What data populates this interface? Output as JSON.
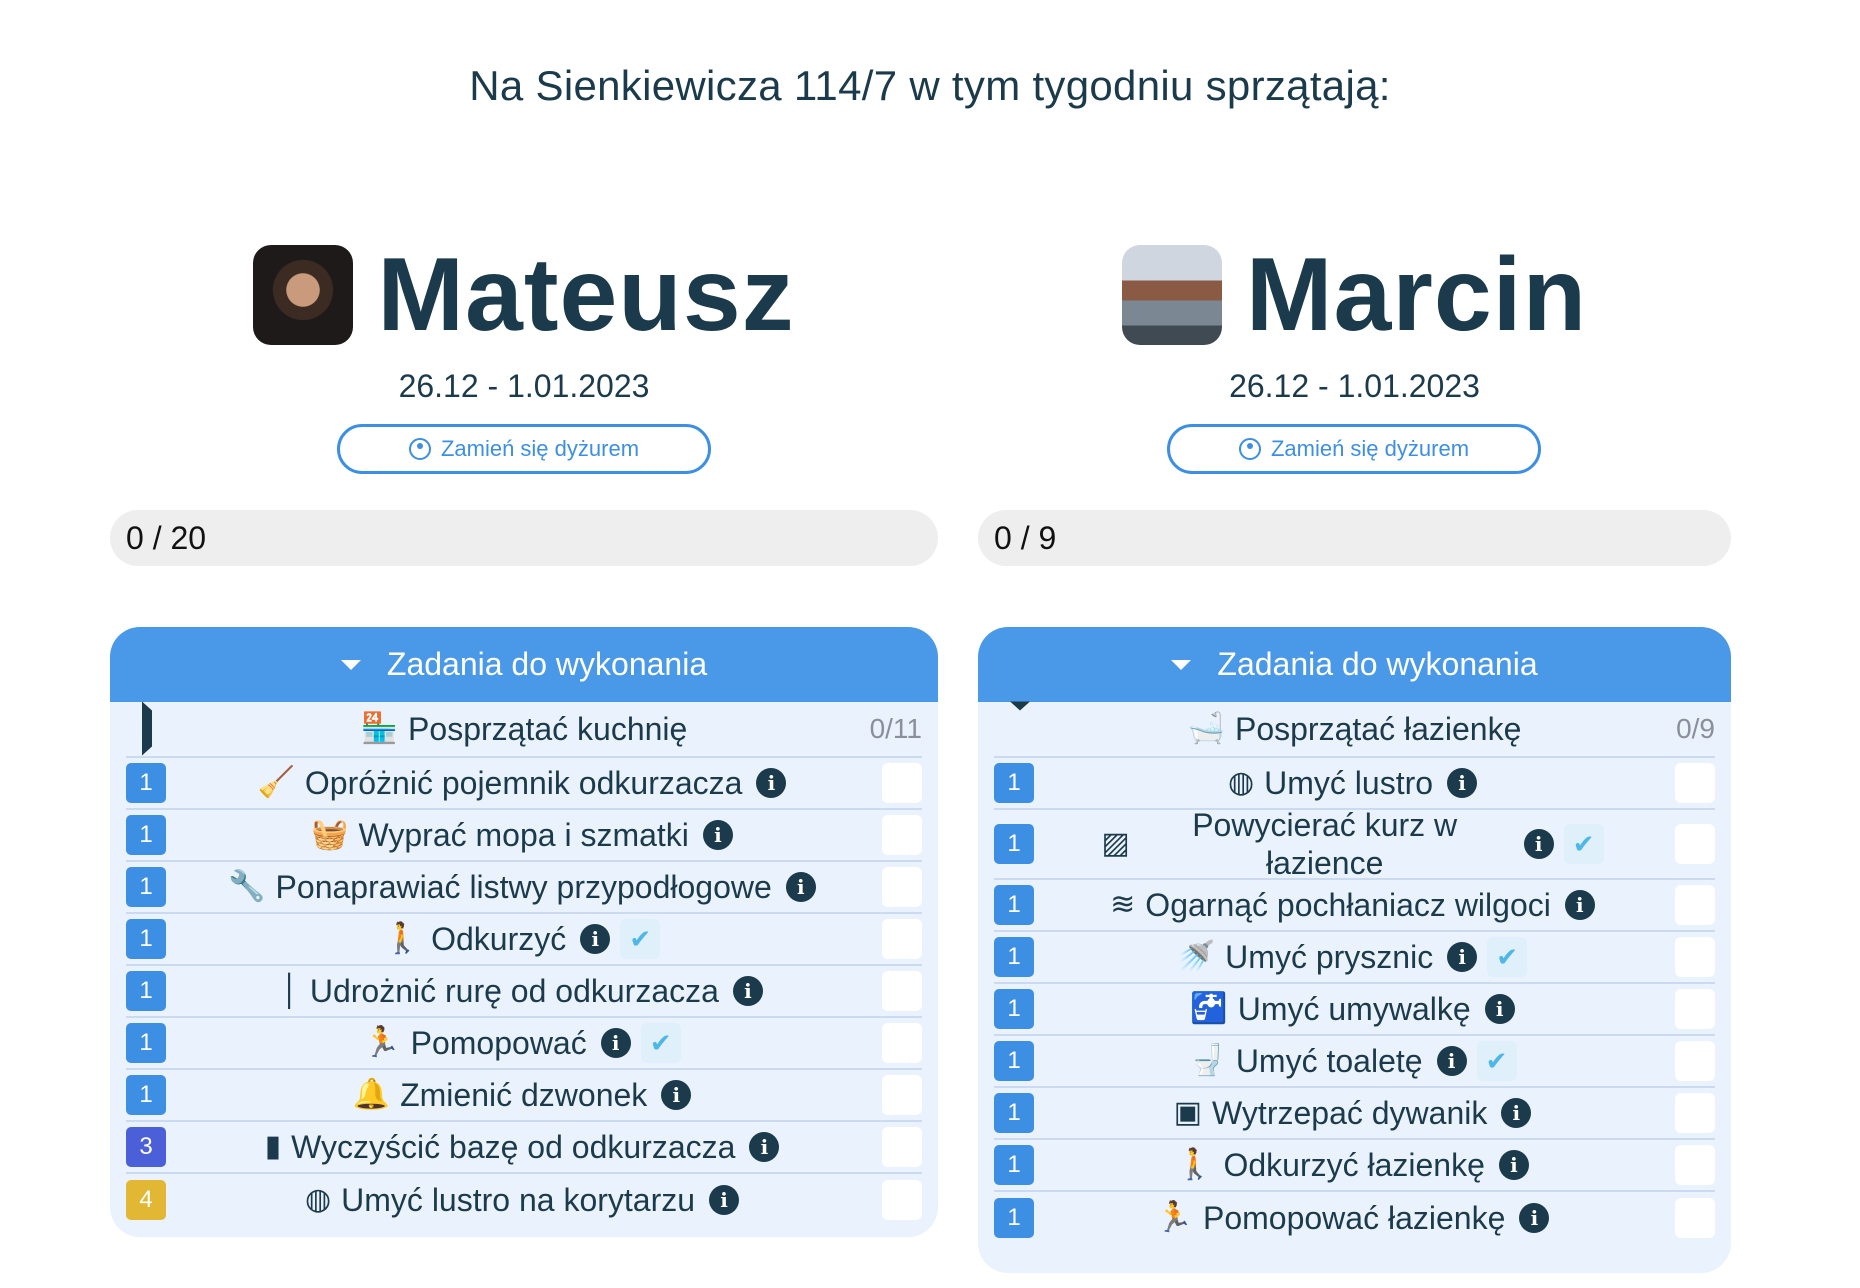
{
  "page": {
    "title": "Na Sienkiewicza 114/7 w tym tygodniu sprzątają:"
  },
  "colors": {
    "accent": "#3d8fe3",
    "header": "#4a99e8",
    "text": "#1b3a4b",
    "badge_blue": "#3d8fe3",
    "badge_indigo": "#4a5fd8",
    "badge_yellow": "#e2b734"
  },
  "people": [
    {
      "name": "Mateusz",
      "date_range": "26.12 - 1.01.2023",
      "swap_label": "Zamień się dyżurem",
      "progress": {
        "label": "0 / 20",
        "fraction": 0
      },
      "section_title": "Zadania do wykonania",
      "group": {
        "label": "Posprzątać kuchnię",
        "count": "0/11",
        "icon": "kitchen-icon",
        "glyph": "🏪",
        "expanded": false
      },
      "tasks": [
        {
          "badge": "1",
          "badge_color": "#3d8fe3",
          "icon": "vacuum-icon",
          "glyph": "🧹",
          "label": "Opróżnić pojemnik odkurzacza",
          "done_mark": false
        },
        {
          "badge": "1",
          "badge_color": "#3d8fe3",
          "icon": "washing-icon",
          "glyph": "🧺",
          "label": "Wyprać mopa i szmatki",
          "done_mark": false
        },
        {
          "badge": "1",
          "badge_color": "#3d8fe3",
          "icon": "tools-icon",
          "glyph": "🔧",
          "label": "Ponaprawiać listwy przypodłogowe",
          "done_mark": false
        },
        {
          "badge": "1",
          "badge_color": "#3d8fe3",
          "icon": "person-vacuum-icon",
          "glyph": "🚶",
          "label": "Odkurzyć",
          "done_mark": true
        },
        {
          "badge": "1",
          "badge_color": "#3d8fe3",
          "icon": "pipe-icon",
          "glyph": "│",
          "label": "Udrożnić rurę od odkurzacza",
          "done_mark": false
        },
        {
          "badge": "1",
          "badge_color": "#3d8fe3",
          "icon": "person-mop-icon",
          "glyph": "🏃",
          "label": "Pomopować",
          "done_mark": true
        },
        {
          "badge": "1",
          "badge_color": "#3d8fe3",
          "icon": "bell-icon",
          "glyph": "🔔",
          "label": "Zmienić dzwonek",
          "done_mark": false
        },
        {
          "badge": "3",
          "badge_color": "#4a5fd8",
          "icon": "vacuum-base-icon",
          "glyph": "▮",
          "label": "Wyczyścić bazę od odkurzacza",
          "done_mark": false
        },
        {
          "badge": "4",
          "badge_color": "#e2b734",
          "icon": "mirror-icon",
          "glyph": "◍",
          "label": "Umyć lustro na korytarzu",
          "done_mark": false
        }
      ]
    },
    {
      "name": "Marcin",
      "date_range": "26.12 - 1.01.2023",
      "swap_label": "Zamień się dyżurem",
      "progress": {
        "label": "0 / 9",
        "fraction": 0
      },
      "section_title": "Zadania do wykonania",
      "group": {
        "label": "Posprzątać łazienkę",
        "count": "0/9",
        "icon": "bath-icon",
        "glyph": "🛁",
        "expanded": true
      },
      "tasks": [
        {
          "badge": "1",
          "badge_color": "#3d8fe3",
          "icon": "mirror-icon",
          "glyph": "◍",
          "label": "Umyć lustro",
          "done_mark": false
        },
        {
          "badge": "1",
          "badge_color": "#3d8fe3",
          "icon": "dust-icon",
          "glyph": "▨",
          "label": "Powycierać kurz w łazience",
          "done_mark": true
        },
        {
          "badge": "1",
          "badge_color": "#3d8fe3",
          "icon": "wind-icon",
          "glyph": "≋",
          "label": "Ogarnąć pochłaniacz wilgoci",
          "done_mark": false
        },
        {
          "badge": "1",
          "badge_color": "#3d8fe3",
          "icon": "shower-icon",
          "glyph": "🚿",
          "label": "Umyć prysznic",
          "done_mark": true
        },
        {
          "badge": "1",
          "badge_color": "#3d8fe3",
          "icon": "sink-icon",
          "glyph": "🚰",
          "label": "Umyć umywalkę",
          "done_mark": false
        },
        {
          "badge": "1",
          "badge_color": "#3d8fe3",
          "icon": "toilet-icon",
          "glyph": "🚽",
          "label": "Umyć toaletę",
          "done_mark": true
        },
        {
          "badge": "1",
          "badge_color": "#3d8fe3",
          "icon": "rug-icon",
          "glyph": "▣",
          "label": "Wytrzepać dywanik",
          "done_mark": false
        },
        {
          "badge": "1",
          "badge_color": "#3d8fe3",
          "icon": "person-vacuum-icon",
          "glyph": "🚶",
          "label": "Odkurzyć łazienkę",
          "done_mark": false
        },
        {
          "badge": "1",
          "badge_color": "#3d8fe3",
          "icon": "person-mop-icon",
          "glyph": "🏃",
          "label": "Pomopować łazienkę",
          "done_mark": false
        }
      ]
    }
  ]
}
